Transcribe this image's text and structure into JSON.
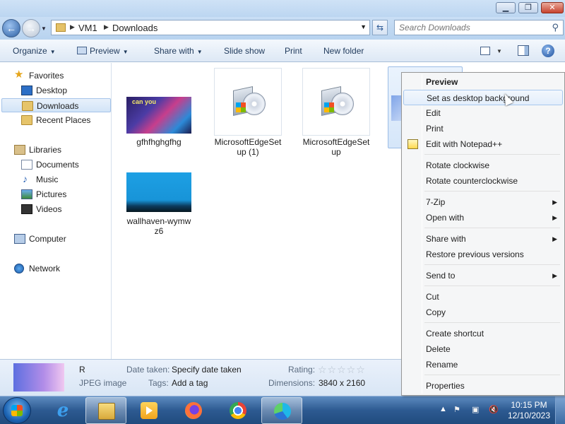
{
  "window": {
    "address": {
      "crumbs": [
        "VM1",
        "Downloads"
      ]
    },
    "search": {
      "placeholder": "Search Downloads"
    }
  },
  "toolbar": {
    "items": [
      "Organize",
      "Preview",
      "Share with",
      "Slide show",
      "Print",
      "New folder"
    ]
  },
  "nav": {
    "favorites": "Favorites",
    "desktop": "Desktop",
    "downloads": "Downloads",
    "recent": "Recent Places",
    "libraries": "Libraries",
    "documents": "Documents",
    "music": "Music",
    "pictures": "Pictures",
    "videos": "Videos",
    "computer": "Computer",
    "network": "Network"
  },
  "files": [
    {
      "name": "gfhfhghgfhg",
      "thumb_text": "can you"
    },
    {
      "name_line1": "MicrosoftEdgeSet",
      "name_line2": "up (1)"
    },
    {
      "name_line1": "MicrosoftEdgeSet",
      "name_line2": "up"
    },
    {
      "name_line1": "wallhaven-wymw",
      "name_line2": "z6"
    }
  ],
  "details": {
    "name": "R",
    "type": "JPEG image",
    "date_label": "Date taken:",
    "date_value": "Specify date taken",
    "tags_label": "Tags:",
    "tags_value": "Add a tag",
    "rating_label": "Rating:",
    "rating_value": 0,
    "dims_label": "Dimensions:",
    "dims_value": "3840 x 2160"
  },
  "context_menu": {
    "preview": "Preview",
    "set_bg": "Set as desktop background",
    "edit": "Edit",
    "print": "Print",
    "edit_npp": "Edit with Notepad++",
    "rot_cw": "Rotate clockwise",
    "rot_ccw": "Rotate counterclockwise",
    "zip": "7-Zip",
    "open_with": "Open with",
    "share_with": "Share with",
    "restore": "Restore previous versions",
    "send_to": "Send to",
    "cut": "Cut",
    "copy": "Copy",
    "create_shortcut": "Create shortcut",
    "delete": "Delete",
    "rename": "Rename",
    "properties": "Properties"
  },
  "taskbar": {
    "clock_time": "10:15 PM",
    "clock_date": "12/10/2023"
  },
  "colors": {
    "taskbar": "#2d5a91",
    "selection": "#d2e4f7",
    "menu_bg": "#f5f6f7"
  }
}
